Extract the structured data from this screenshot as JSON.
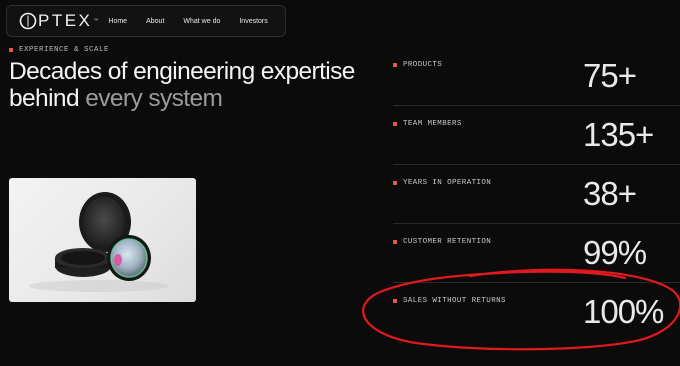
{
  "nav": {
    "logo_text": "PTEX",
    "logo_tm": "™",
    "links": [
      "Home",
      "About",
      "What we do",
      "Investors"
    ]
  },
  "hero": {
    "eyebrow": "EXPERIENCE & SCALE",
    "headline_main": "Decades of engineering expertise behind",
    "headline_muted": "every system"
  },
  "stats": [
    {
      "label": "PRODUCTS",
      "value": "75+"
    },
    {
      "label": "TEAM MEMBERS",
      "value": "135+"
    },
    {
      "label": "YEARS IN OPERATION",
      "value": "38+"
    },
    {
      "label": "CUSTOMER RETENTION",
      "value": "99%"
    },
    {
      "label": "SALES WITHOUT RETURNS",
      "value": "100%"
    }
  ],
  "colors": {
    "background": "#0b0b0b",
    "accent": "#e05a4a",
    "annotation": "#e0191f"
  }
}
